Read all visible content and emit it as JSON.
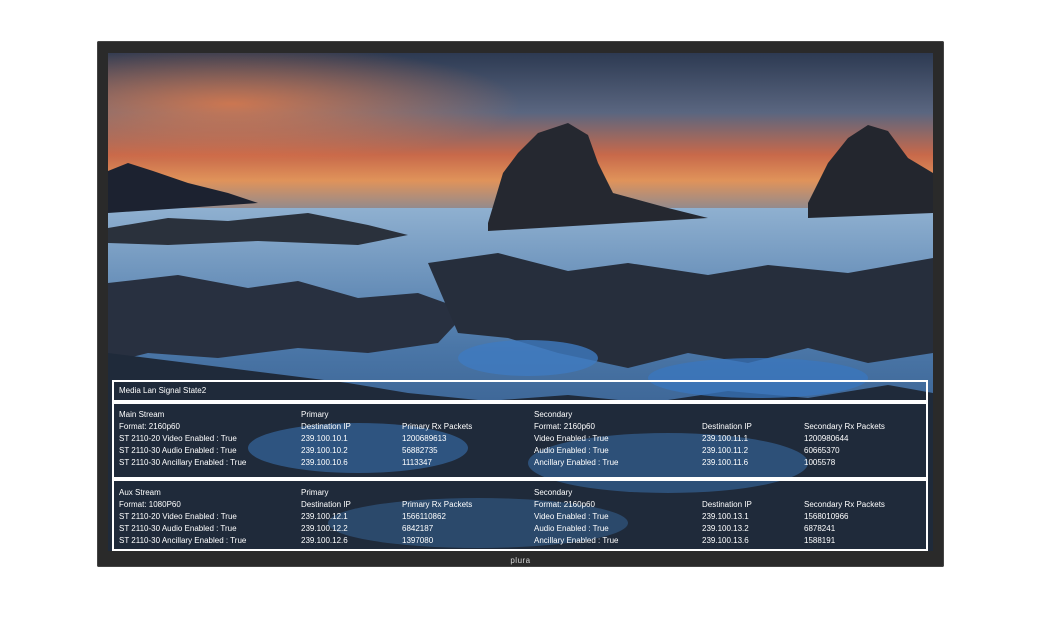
{
  "monitor": {
    "brand": "plura"
  },
  "overlay": {
    "title": "Media Lan Signal State2",
    "main_stream": {
      "heading": "Main Stream",
      "format": "Format: 2160p60",
      "video": "ST 2110-20 Video Enabled : True",
      "audio": "ST 2110-30 Audio Enabled : True",
      "ancillary": "ST 2110-30 Ancillary Enabled : True",
      "primary": {
        "heading": "Primary",
        "dest_ip_label": "Destination IP",
        "rx_label": "Primary Rx Packets",
        "video_ip": "239.100.10.1",
        "audio_ip": "239.100.10.2",
        "anc_ip": "239.100.10.6",
        "video_rx": "1200689613",
        "audio_rx": "56882735",
        "anc_rx": "1113347"
      },
      "secondary": {
        "heading": "Secondary",
        "format": "Format: 2160p60",
        "video": "Video Enabled : True",
        "audio": "Audio Enabled : True",
        "ancillary": "Ancillary Enabled : True",
        "dest_ip_label": "Destination IP",
        "rx_label": "Secondary Rx Packets",
        "video_ip": "239.100.11.1",
        "audio_ip": "239.100.11.2",
        "anc_ip": "239.100.11.6",
        "video_rx": "1200980644",
        "audio_rx": "60665370",
        "anc_rx": "1005578"
      }
    },
    "aux_stream": {
      "heading": "Aux Stream",
      "format": "Format: 1080P60",
      "video": "ST 2110-20 Video Enabled : True",
      "audio": "ST 2110-30 Audio Enabled : True",
      "ancillary": "ST 2110-30 Ancillary Enabled : True",
      "primary": {
        "heading": "Primary",
        "dest_ip_label": "Destination IP",
        "rx_label": "Primary Rx Packets",
        "video_ip": "239.100.12.1",
        "audio_ip": "239.100.12.2",
        "anc_ip": "239.100.12.6",
        "video_rx": "1566110862",
        "audio_rx": "6842187",
        "anc_rx": "1397080"
      },
      "secondary": {
        "heading": "Secondary",
        "format": "Format: 2160p60",
        "video": "Video Enabled : True",
        "audio": "Audio Enabled : True",
        "ancillary": "Ancillary Enabled : True",
        "dest_ip_label": "Destination IP",
        "rx_label": "Secondary Rx Packets",
        "video_ip": "239.100.13.1",
        "audio_ip": "239.100.13.2",
        "anc_ip": "239.100.13.6",
        "video_rx": "1568010966",
        "audio_rx": "6878241",
        "anc_rx": "1588191"
      }
    }
  }
}
